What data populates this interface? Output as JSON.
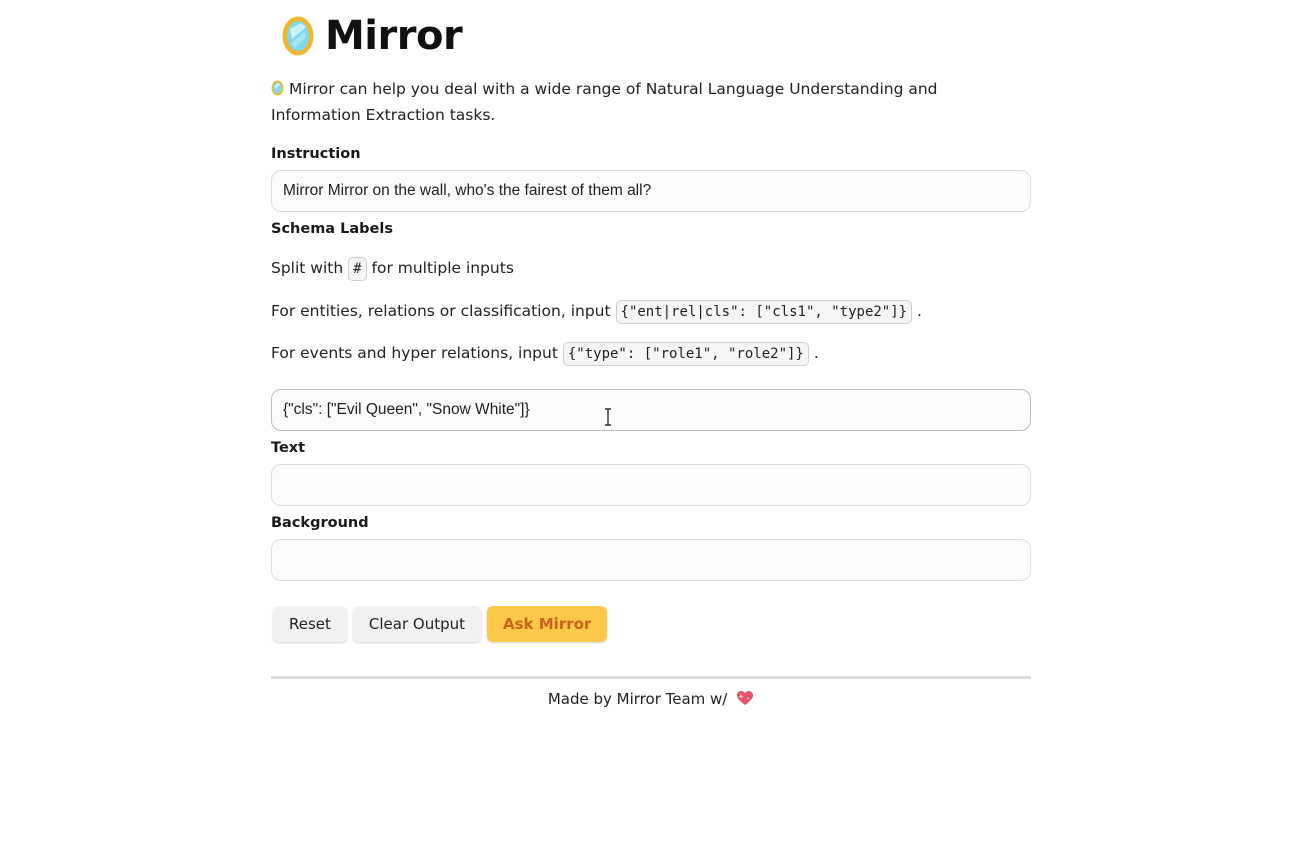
{
  "app": {
    "title": "Mirror",
    "logo_icon": "mirror-logo-icon",
    "intro_text": "Mirror can help you deal with a wide range of Natural Language Understanding and Information Extraction tasks."
  },
  "instruction": {
    "label": "Instruction",
    "value": "Mirror Mirror on the wall, who's the fairest of them all?",
    "placeholder": ""
  },
  "schema": {
    "label": "Schema Labels",
    "help_split_prefix": "Split with",
    "help_split_code": "#",
    "help_split_suffix": "for multiple inputs",
    "help_ent_prefix": "For entities, relations or classification, input",
    "help_ent_code": "{\"ent|rel|cls\": [\"cls1\", \"type2\"]}",
    "help_ent_suffix": ".",
    "help_event_prefix": "For events and hyper relations, input",
    "help_event_code": "{\"type\": [\"role1\", \"role2\"]}",
    "help_event_suffix": ".",
    "value": "{\"cls\": [\"Evil Queen\", \"Snow White\"]}",
    "placeholder": ""
  },
  "text_field": {
    "label": "Text",
    "value": "",
    "placeholder": ""
  },
  "background_field": {
    "label": "Background",
    "value": "",
    "placeholder": ""
  },
  "buttons": {
    "reset": "Reset",
    "clear_output": "Clear Output",
    "ask": "Ask Mirror"
  },
  "footer": {
    "text": "Made by Mirror Team w/",
    "heart_icon": "sparkling-heart-icon"
  },
  "colors": {
    "primary_button_bg": "#fcc94a",
    "primary_button_text": "#c7641a",
    "secondary_button_bg": "#f1f1f1",
    "field_border": "#dcdcdc"
  }
}
